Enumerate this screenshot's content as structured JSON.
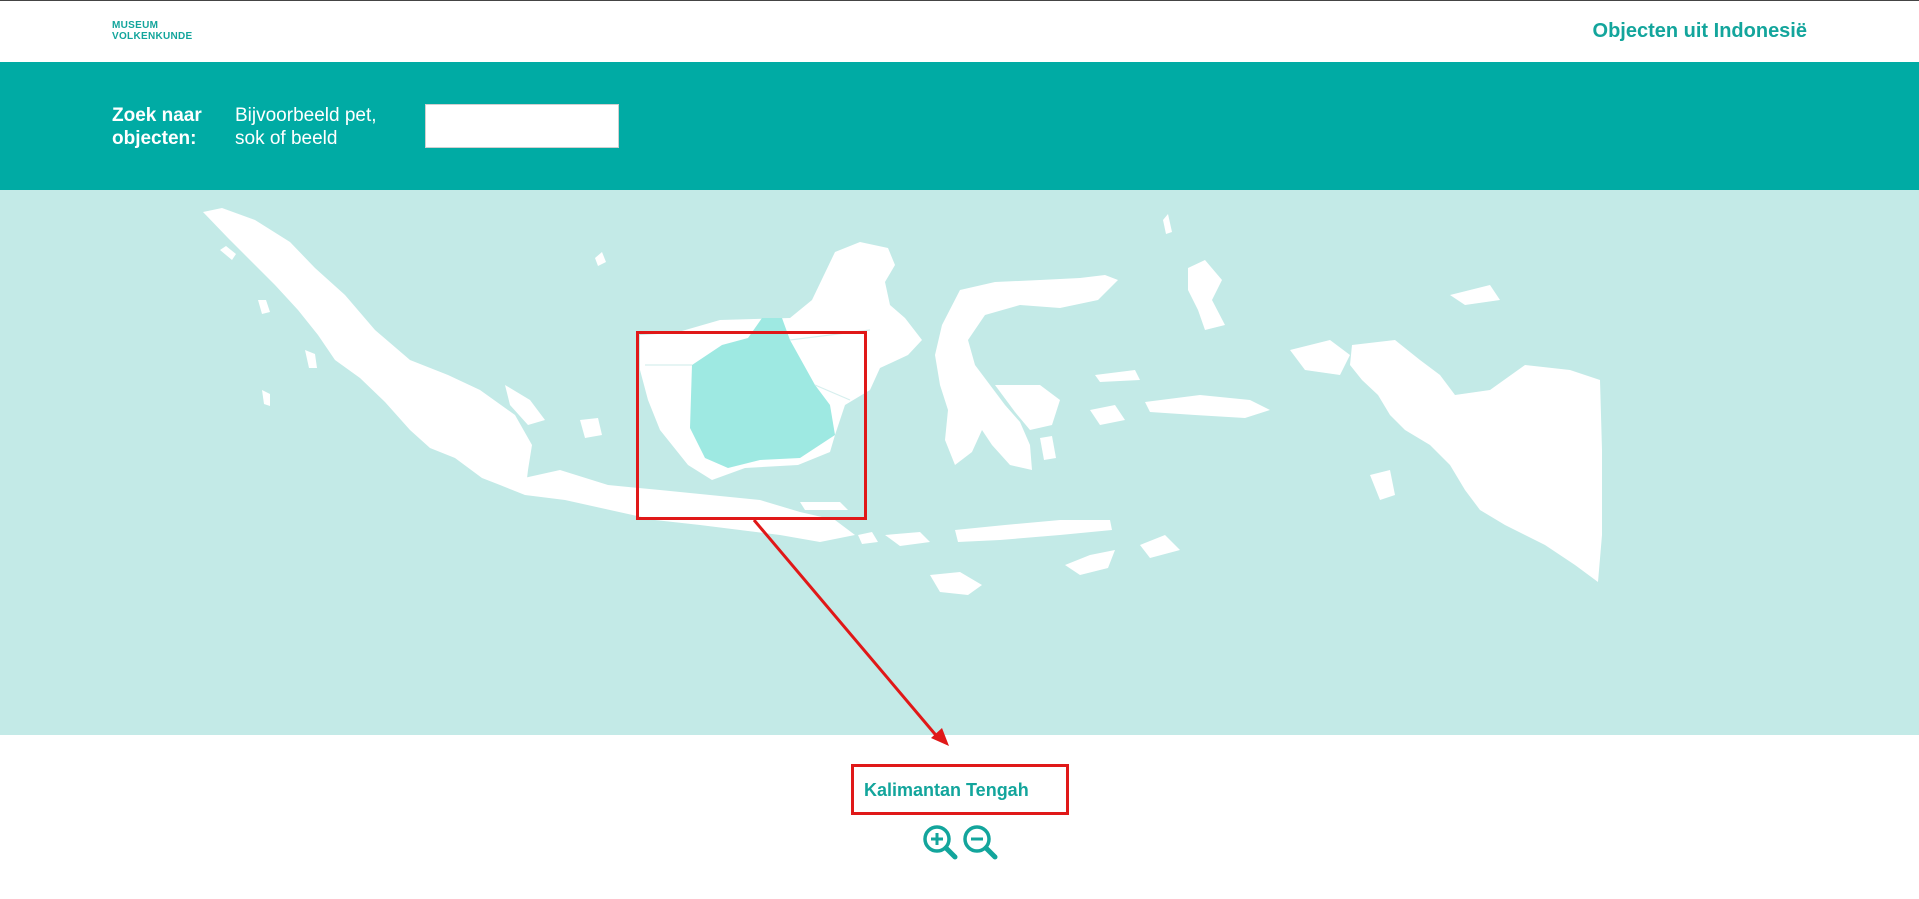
{
  "header": {
    "logo_line1": "MUSEUM",
    "logo_line2": "VOLKENKUNDE",
    "title": "Objecten uit Indonesië"
  },
  "search": {
    "label": "Zoek naar objecten:",
    "hint": "Bijvoorbeeld pet, sok of beeld",
    "value": "",
    "placeholder": ""
  },
  "map": {
    "selected_region": "Kalimantan Tengah",
    "selected_color": "#9ee9e2",
    "land_color": "#ffffff",
    "water_color": "#c3eae7"
  },
  "controls": {
    "zoom_in_icon": "zoom-in-icon",
    "zoom_out_icon": "zoom-out-icon"
  },
  "colors": {
    "brand": "#13a59c",
    "search_bar": "#00aba4",
    "annotation": "#e01818"
  }
}
